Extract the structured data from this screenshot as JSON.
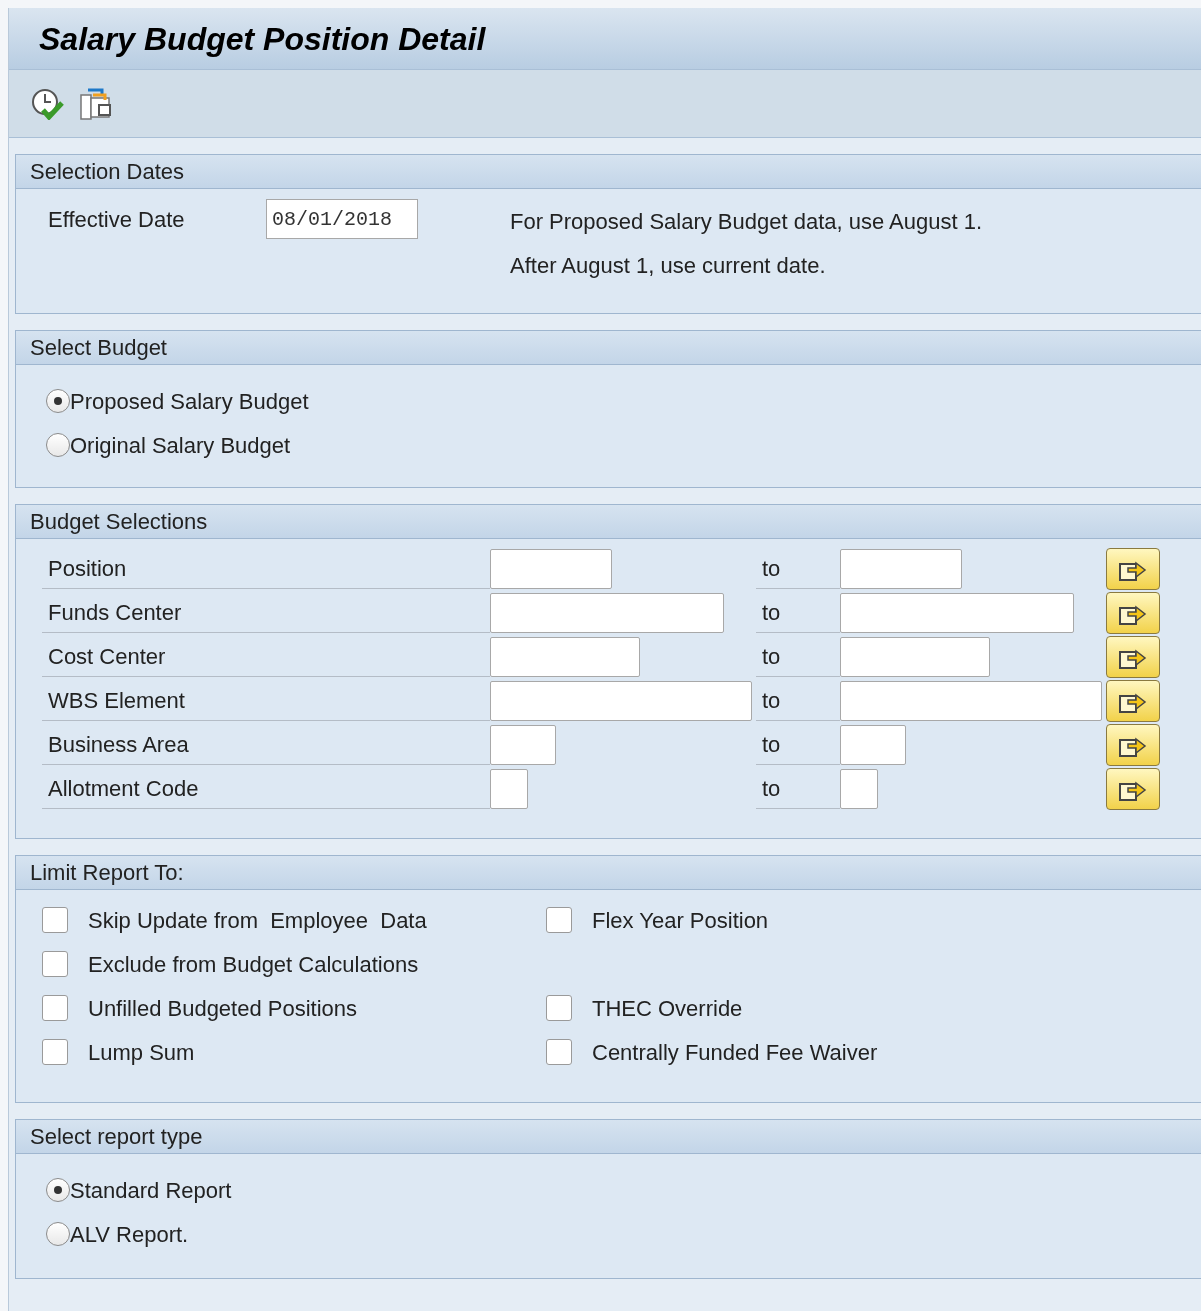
{
  "window": {
    "title": "Salary Budget Position Detail"
  },
  "selection_dates": {
    "title": "Selection Dates",
    "label": "Effective Date",
    "value": "08/01/2018",
    "notes": [
      "For Proposed Salary Budget data, use August 1.",
      "After August 1, use current date."
    ]
  },
  "select_budget": {
    "title": "Select Budget",
    "options": [
      {
        "label": "Proposed Salary Budget",
        "selected": true
      },
      {
        "label": "Original Salary Budget",
        "selected": false
      }
    ]
  },
  "budget_selections": {
    "title": "Budget Selections",
    "rows": [
      {
        "label": "Position",
        "to": "to"
      },
      {
        "label": "Funds Center",
        "to": "to"
      },
      {
        "label": "Cost Center",
        "to": "to"
      },
      {
        "label": "WBS Element",
        "to": "to"
      },
      {
        "label": "Business Area",
        "to": "to"
      },
      {
        "label": "Allotment Code",
        "to": "to"
      }
    ]
  },
  "limit_report": {
    "title": "Limit Report To:",
    "rows": [
      [
        {
          "label": "Skip Update from  Employee  Data",
          "checked": false
        },
        {
          "label": "Flex Year Position",
          "checked": false
        }
      ],
      [
        {
          "label": "Exclude from Budget Calculations",
          "checked": false
        }
      ],
      [
        {
          "label": "Unfilled Budgeted Positions",
          "checked": false
        },
        {
          "label": "THEC Override",
          "checked": false
        }
      ],
      [
        {
          "label": "Lump Sum",
          "checked": false
        },
        {
          "label": "Centrally Funded Fee Waiver",
          "checked": false
        }
      ]
    ]
  },
  "report_type": {
    "title": "Select report type",
    "options": [
      {
        "label": "Standard Report",
        "selected": true
      },
      {
        "label": "ALV Report.",
        "selected": false
      }
    ]
  }
}
